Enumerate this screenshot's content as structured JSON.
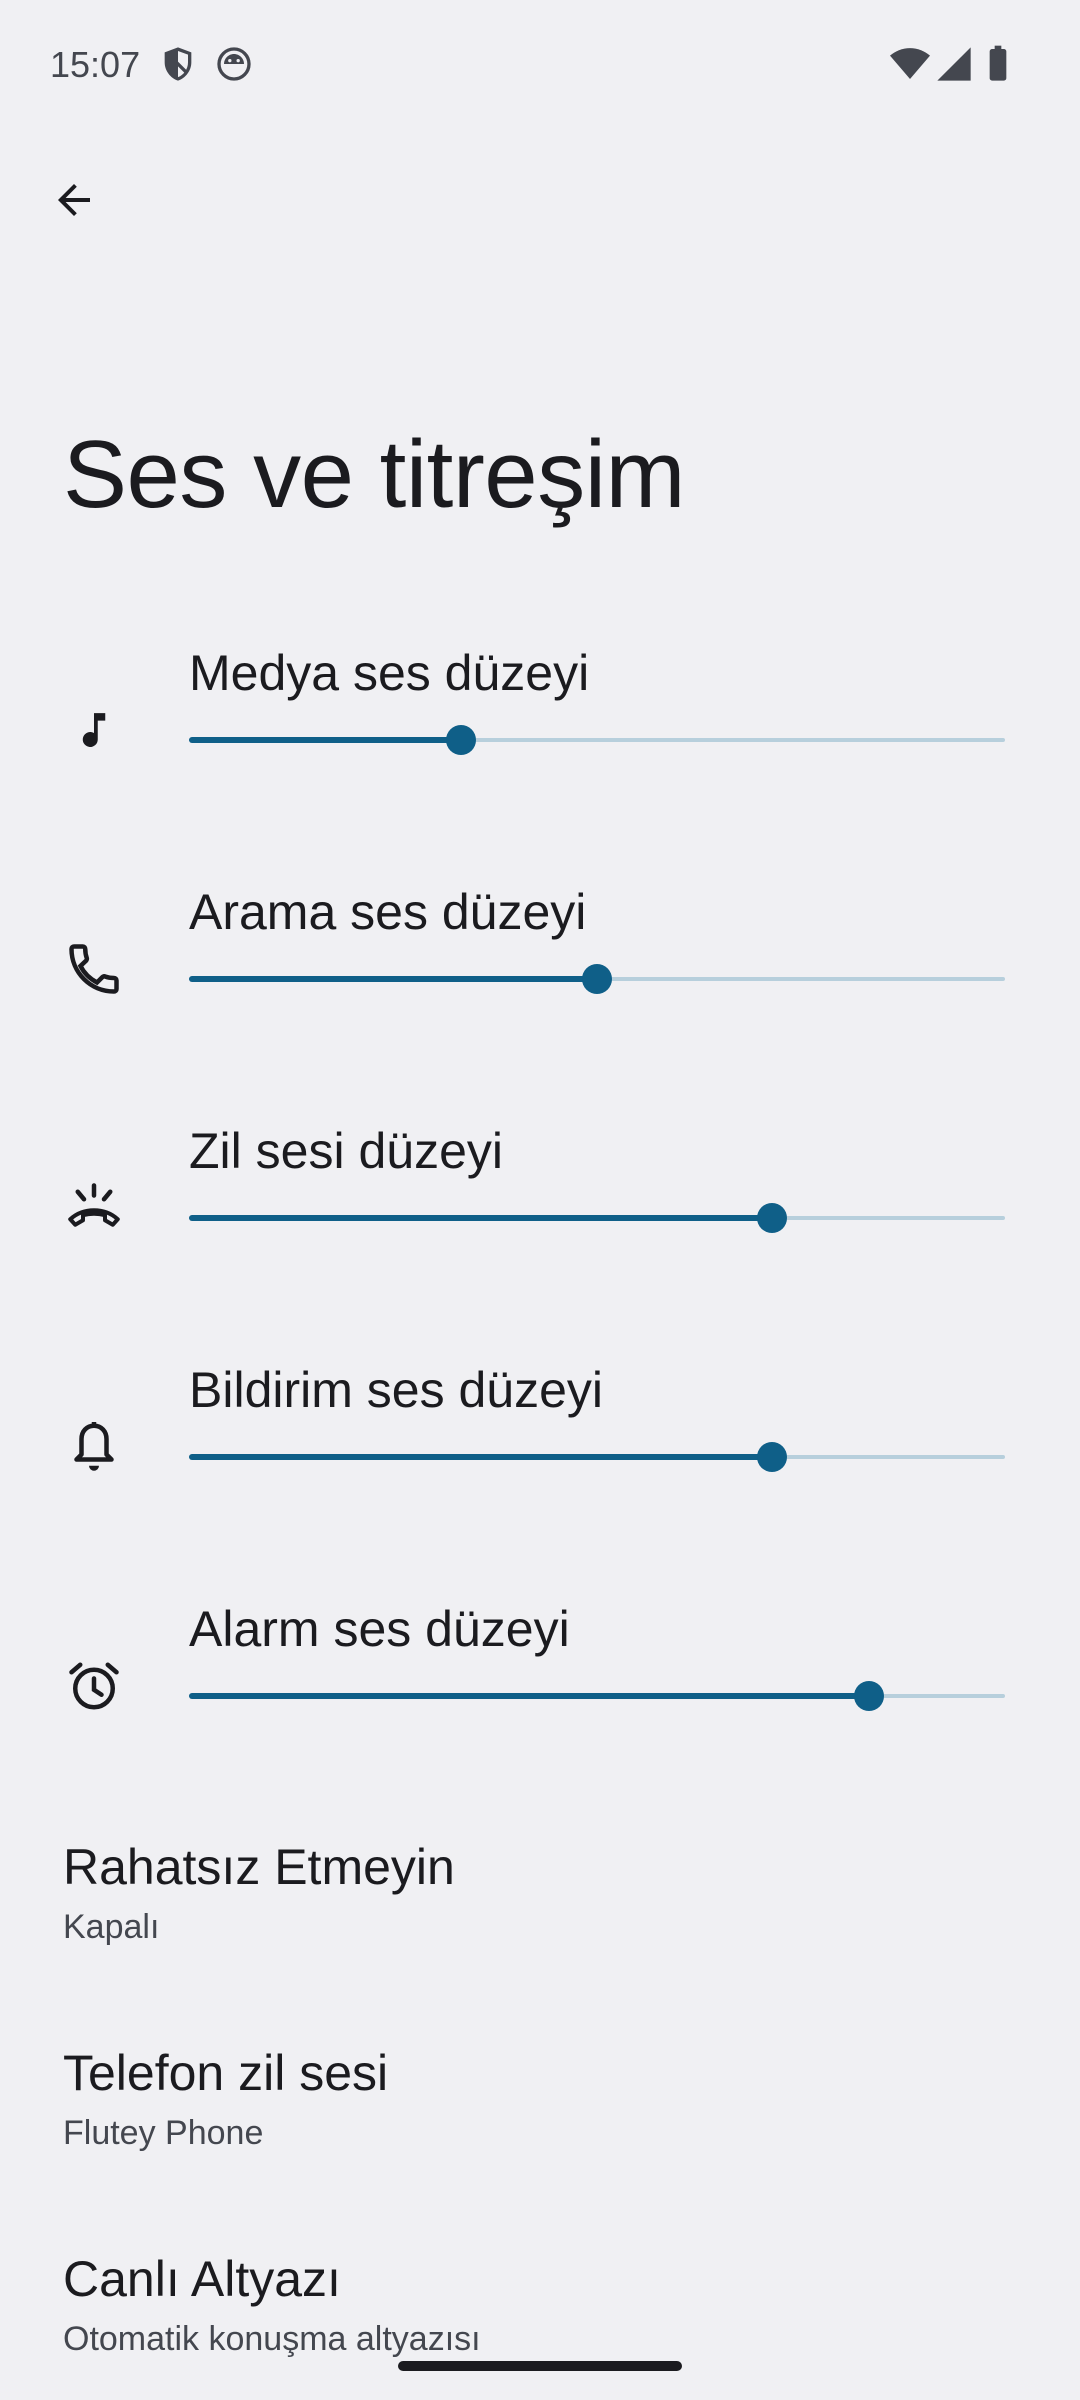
{
  "status_bar": {
    "time": "15:07",
    "icons_left": [
      "shield-icon",
      "android-head-icon"
    ],
    "icons_right": [
      "wifi-icon",
      "cellular-signal-icon",
      "battery-icon"
    ]
  },
  "header": {
    "back_icon": "arrow-back-icon"
  },
  "page": {
    "title": "Ses ve titreşim"
  },
  "volumes": [
    {
      "key": "media",
      "label": "Medya ses düzeyi",
      "icon": "music-note-icon",
      "level": 0.333
    },
    {
      "key": "call",
      "label": "Arama ses düzeyi",
      "icon": "phone-icon",
      "level": 0.5
    },
    {
      "key": "ring",
      "label": "Zil sesi düzeyi",
      "icon": "ringing-phone-icon",
      "level": 0.714
    },
    {
      "key": "notification",
      "label": "Bildirim ses düzeyi",
      "icon": "bell-icon",
      "level": 0.714
    },
    {
      "key": "alarm",
      "label": "Alarm ses düzeyi",
      "icon": "alarm-clock-icon",
      "level": 0.833
    }
  ],
  "settings": [
    {
      "title": "Rahatsız Etmeyin",
      "summary": "Kapalı"
    },
    {
      "title": "Telefon zil sesi",
      "summary": "Flutey Phone"
    },
    {
      "title": "Canlı Altyazı",
      "summary": "Otomatik konuşma altyazısı"
    }
  ],
  "colors": {
    "background": "#f0f0f3",
    "accent": "#0f5f88",
    "track_inactive": "#b7cfdc",
    "text_primary": "#1b1b1f",
    "text_secondary": "#44474f"
  }
}
